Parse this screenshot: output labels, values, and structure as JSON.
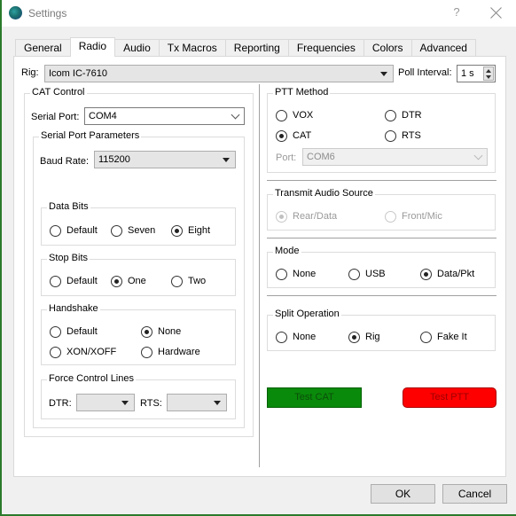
{
  "window": {
    "title": "Settings",
    "help_label": "?"
  },
  "tabs": [
    {
      "label": "General",
      "active": false
    },
    {
      "label": "Radio",
      "active": true
    },
    {
      "label": "Audio",
      "active": false
    },
    {
      "label": "Tx Macros",
      "active": false
    },
    {
      "label": "Reporting",
      "active": false
    },
    {
      "label": "Frequencies",
      "active": false
    },
    {
      "label": "Colors",
      "active": false
    },
    {
      "label": "Advanced",
      "active": false
    }
  ],
  "rig": {
    "label": "Rig:",
    "value": "Icom IC-7610",
    "poll_label": "Poll Interval:",
    "poll_value": "1 s"
  },
  "cat_control": {
    "title": "CAT Control",
    "serial_port_label": "Serial Port:",
    "serial_port_value": "COM4",
    "serial_params": {
      "title": "Serial Port Parameters",
      "baud_label": "Baud Rate:",
      "baud_value": "115200",
      "data_bits": {
        "title": "Data Bits",
        "options": [
          "Default",
          "Seven",
          "Eight"
        ],
        "selected": "Eight"
      },
      "stop_bits": {
        "title": "Stop Bits",
        "options": [
          "Default",
          "One",
          "Two"
        ],
        "selected": "One"
      },
      "handshake": {
        "title": "Handshake",
        "options": [
          "Default",
          "None",
          "XON/XOFF",
          "Hardware"
        ],
        "selected": "None"
      },
      "force_control_lines": {
        "title": "Force Control Lines",
        "dtr_label": "DTR:",
        "dtr_value": "",
        "rts_label": "RTS:",
        "rts_value": ""
      }
    }
  },
  "ptt_method": {
    "title": "PTT Method",
    "options": [
      "VOX",
      "DTR",
      "CAT",
      "RTS"
    ],
    "selected": "CAT",
    "port_label": "Port:",
    "port_value": "COM6"
  },
  "transmit_audio_source": {
    "title": "Transmit Audio Source",
    "options": [
      "Rear/Data",
      "Front/Mic"
    ],
    "selected": "Rear/Data",
    "disabled": true
  },
  "mode": {
    "title": "Mode",
    "options": [
      "None",
      "USB",
      "Data/Pkt"
    ],
    "selected": "Data/Pkt"
  },
  "split_operation": {
    "title": "Split Operation",
    "options": [
      "None",
      "Rig",
      "Fake It"
    ],
    "selected": "Rig"
  },
  "test_buttons": {
    "test_cat_label": "Test CAT",
    "test_ptt_label": "Test PTT",
    "test_cat_color": "#0a8a0a",
    "test_ptt_color": "#ff0000"
  },
  "footer": {
    "ok_label": "OK",
    "cancel_label": "Cancel"
  }
}
